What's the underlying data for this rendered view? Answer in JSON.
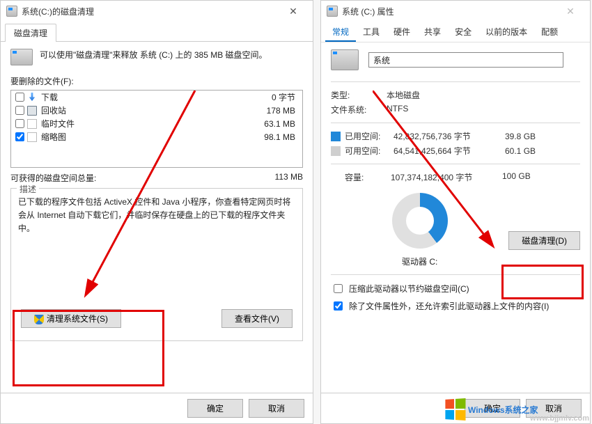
{
  "cleanup": {
    "title": "系统(C:)的磁盘清理",
    "tab": "磁盘清理",
    "intro": "可以使用\"磁盘清理\"来释放 系统 (C:) 上的 385 MB 磁盘空间。",
    "files_label": "要删除的文件(F):",
    "items": [
      {
        "name": "下载",
        "size": "0 字节",
        "checked": false,
        "icon": "dl"
      },
      {
        "name": "回收站",
        "size": "178 MB",
        "checked": false,
        "icon": "rb"
      },
      {
        "name": "临时文件",
        "size": "63.1 MB",
        "checked": false,
        "icon": "pg"
      },
      {
        "name": "缩略图",
        "size": "98.1 MB",
        "checked": true,
        "icon": "pg"
      }
    ],
    "gain_label": "可获得的磁盘空间总量:",
    "gain_value": "113 MB",
    "desc_title": "描述",
    "desc_body": "已下载的程序文件包括 ActiveX 控件和 Java 小程序，你查看特定网页时将会从 Internet 自动下载它们，并临时保存在硬盘上的已下载的程序文件夹中。",
    "clean_sys_btn": "清理系统文件(S)",
    "view_files_btn": "查看文件(V)",
    "ok": "确定",
    "cancel": "取消"
  },
  "props": {
    "title": "系统 (C:) 属性",
    "tabs": [
      "常规",
      "工具",
      "硬件",
      "共享",
      "安全",
      "以前的版本",
      "配额"
    ],
    "name_value": "系统",
    "type_k": "类型:",
    "type_v": "本地磁盘",
    "fs_k": "文件系统:",
    "fs_v": "NTFS",
    "used_k": "已用空间:",
    "used_bytes": "42,832,756,736 字节",
    "used_h": "39.8 GB",
    "free_k": "可用空间:",
    "free_bytes": "64,541,425,664 字节",
    "free_h": "60.1 GB",
    "cap_k": "容量:",
    "cap_bytes": "107,374,182,400 字节",
    "cap_h": "100 GB",
    "drive_label": "驱动器 C:",
    "disk_clean_btn": "磁盘清理(D)",
    "compress_cb": "压缩此驱动器以节约磁盘空间(C)",
    "index_cb": "除了文件属性外，还允许索引此驱动器上文件的内容(I)",
    "ok": "确定",
    "cancel": "取消"
  },
  "colors": {
    "used": "#2188d9",
    "free": "#e0e0e0"
  },
  "branding": {
    "logo_text": "Windows系统之家",
    "watermark": "www.bjjmlv.com"
  }
}
